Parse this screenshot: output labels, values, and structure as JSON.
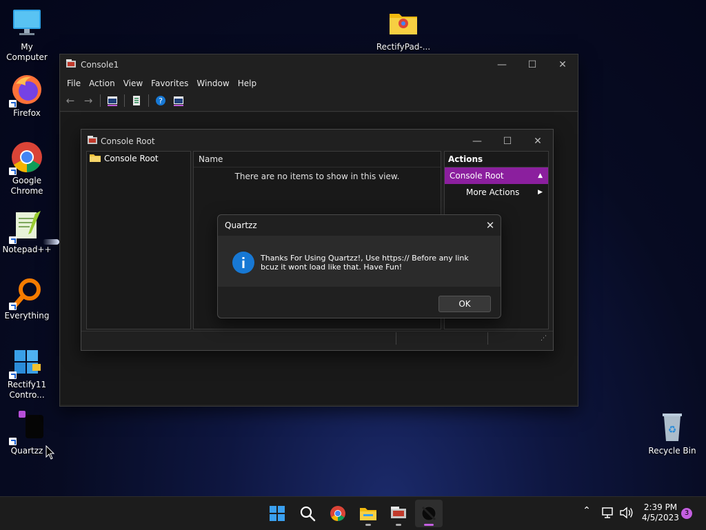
{
  "desktop": {
    "icons": [
      {
        "label": "My Computer"
      },
      {
        "label": "Firefox"
      },
      {
        "label": "Google Chrome"
      },
      {
        "label": "Notepad++"
      },
      {
        "label": "Everything"
      },
      {
        "label": "Rectify11 Contro..."
      },
      {
        "label": "Quartzz"
      },
      {
        "label": "RectifyPad-..."
      },
      {
        "label": "Recycle Bin"
      }
    ]
  },
  "console_window": {
    "title": "Console1",
    "menu": [
      "File",
      "Action",
      "View",
      "Favorites",
      "Window",
      "Help"
    ]
  },
  "child_window": {
    "title": "Console Root",
    "tree_root": "Console Root",
    "column_header": "Name",
    "empty_message": "There are no items to show in this view.",
    "actions_header": "Actions",
    "actions_selected": "Console Root",
    "actions_more": "More Actions"
  },
  "dialog": {
    "title": "Quartzz",
    "message": "Thanks For Using Quartzz!, Use https:// Before any link bcuz it wont load like that. Have Fun!",
    "ok_label": "OK"
  },
  "taskbar": {
    "time": "2:39 PM",
    "date": "4/5/2023",
    "notification_count": "3"
  },
  "colors": {
    "accent_purple": "#8b1f9e",
    "info_blue": "#1778d4"
  }
}
